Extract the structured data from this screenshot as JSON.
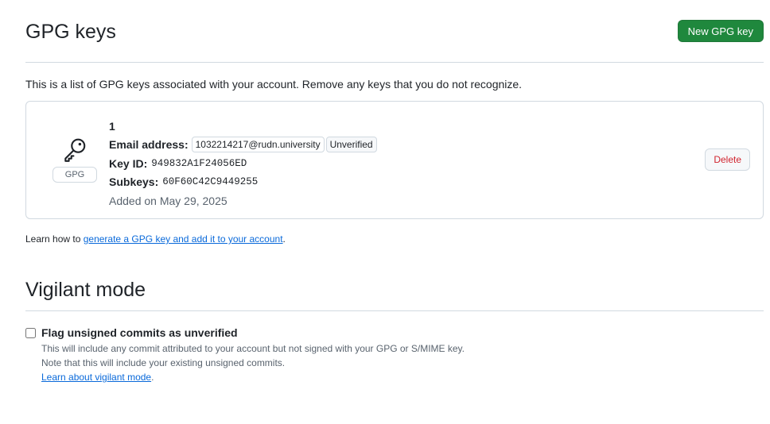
{
  "gpg": {
    "title": "GPG keys",
    "new_button": "New GPG key",
    "intro": "This is a list of GPG keys associated with your account. Remove any keys that you do not recognize.",
    "keys": [
      {
        "icon": "key-icon",
        "type_label": "GPG",
        "name": "1",
        "email_label": "Email address:",
        "email": "1032214217@rudn.university",
        "status": "Unverified",
        "key_id_label": "Key ID:",
        "key_id": "949832A1F24056ED",
        "subkeys_label": "Subkeys:",
        "subkeys": "60F60C42C9449255",
        "added": "Added on May 29, 2025",
        "delete_label": "Delete"
      }
    ],
    "learn_prefix": "Learn how to ",
    "learn_link": "generate a GPG key and add it to your account",
    "learn_suffix": "."
  },
  "vigilant": {
    "title": "Vigilant mode",
    "checkbox_label": "Flag unsigned commits as unverified",
    "checked": false,
    "note1": "This will include any commit attributed to your account but not signed with your GPG or S/MIME key.",
    "note2": "Note that this will include your existing unsigned commits.",
    "learn_link": "Learn about vigilant mode",
    "learn_suffix": "."
  }
}
